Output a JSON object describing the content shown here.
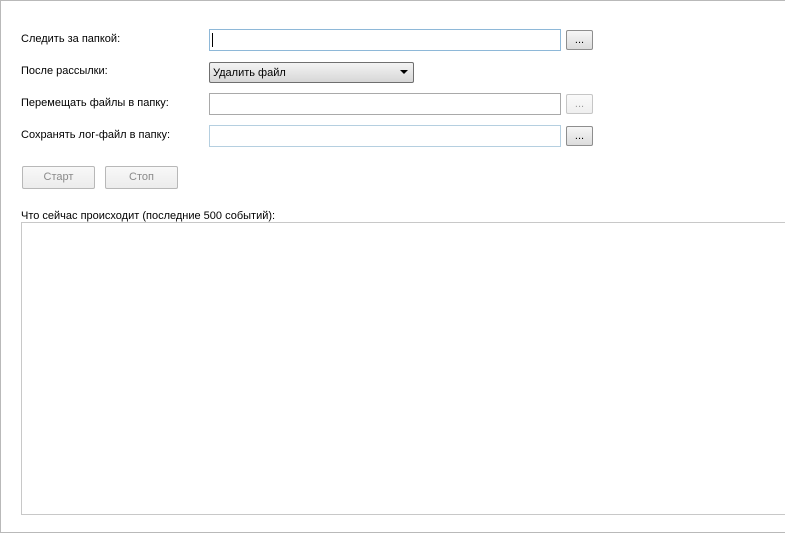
{
  "form": {
    "watch_folder": {
      "label": "Следить за папкой:",
      "value": "",
      "browse_label": "..."
    },
    "after_send": {
      "label": "После рассылки:",
      "selected": "Удалить файл"
    },
    "move_folder": {
      "label": "Перемещать файлы в папку:",
      "value": "",
      "browse_label": "..."
    },
    "log_folder": {
      "label": "Сохранять лог-файл в папку:",
      "value": "",
      "browse_label": "..."
    }
  },
  "controls": {
    "start_label": "Старт",
    "stop_label": "Стоп"
  },
  "log": {
    "label": "Что сейчас происходит (последние 500 событий):",
    "content": ""
  }
}
